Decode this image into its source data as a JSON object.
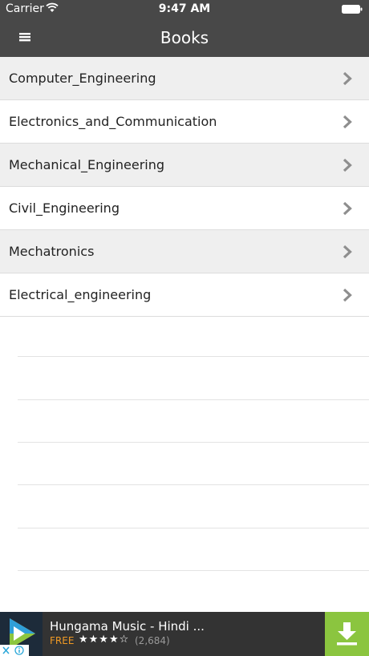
{
  "status_bar": {
    "carrier": "Carrier",
    "time": "9:47 AM",
    "icons": [
      "wifi-icon",
      "battery-icon"
    ]
  },
  "header": {
    "title": "Books",
    "menu_icon": "hamburger-menu-icon"
  },
  "list": {
    "items": [
      {
        "label": "Computer_Engineering"
      },
      {
        "label": "Electronics_and_Communication"
      },
      {
        "label": "Mechanical_Engineering"
      },
      {
        "label": "Civil_Engineering"
      },
      {
        "label": "Mechatronics"
      },
      {
        "label": "Electrical_engineering"
      }
    ],
    "row_icon": "chevron-right-icon"
  },
  "ad": {
    "app_name": "Hungama Music - Hindi ...",
    "price": "FREE",
    "stars": "★★★★☆",
    "rating_count": "(2,684)",
    "icons": [
      "hungama-play-logo-icon",
      "download-icon",
      "adchoices-icon",
      "close-icon"
    ]
  },
  "colors": {
    "header_bg": "#484848",
    "row_alt_bg": "#efefef",
    "download_green": "#8bc53f",
    "price_orange": "#f09a24",
    "chevron_gray": "#8e8e8e"
  }
}
